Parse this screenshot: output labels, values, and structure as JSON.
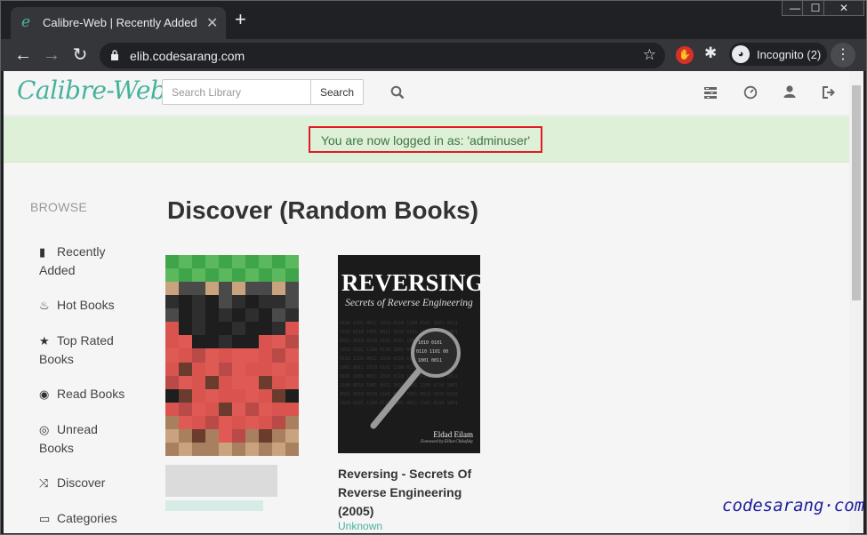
{
  "browser": {
    "tab_title": "Calibre-Web | Recently Added Bo",
    "favicon": "e",
    "tab_close": "✕",
    "new_tab": "+",
    "url": "elib.codesarang.com",
    "incognito_label": "Incognito (2)",
    "window_controls": {
      "minimize": "—",
      "maximize": "☐",
      "close": "✕"
    }
  },
  "app": {
    "brand": "Calibre-Web",
    "search": {
      "placeholder": "Search Library",
      "button": "Search"
    },
    "nav_icons": [
      "tasks-icon",
      "dashboard-icon",
      "user-icon",
      "logout-icon"
    ]
  },
  "alert": {
    "message": "You are now logged in as: 'adminuser'"
  },
  "sidebar": {
    "heading": "BROWSE",
    "items": [
      {
        "icon": "book-icon",
        "glyph": "▮",
        "label_1": "Recently",
        "label_2": "Added"
      },
      {
        "icon": "fire-icon",
        "glyph": "♨",
        "label_1": "Hot Books",
        "label_2": ""
      },
      {
        "icon": "star-icon",
        "glyph": "★",
        "label_1": "Top Rated",
        "label_2": "Books"
      },
      {
        "icon": "eye-icon",
        "glyph": "◉",
        "label_1": "Read Books",
        "label_2": ""
      },
      {
        "icon": "eye-slash-icon",
        "glyph": "◎",
        "label_1": "Unread",
        "label_2": "Books"
      },
      {
        "icon": "shuffle-icon",
        "glyph": "⤨",
        "label_1": "Discover",
        "label_2": ""
      },
      {
        "icon": "inbox-icon",
        "glyph": "▭",
        "label_1": "Categories",
        "label_2": ""
      }
    ]
  },
  "main": {
    "title": "Discover (Random Books)",
    "books": [
      {
        "cover_title": "REVERSING",
        "cover_subtitle": "Secrets of Reverse Engineering",
        "cover_author": "Eldad Eilam",
        "cover_foreword": "Foreword by Elliot Chikofsky",
        "title_line_1": "Reversing - Secrets Of",
        "title_line_2": "Reverse Engineering",
        "title_line_3": "(2005)",
        "author": "Unknown"
      }
    ]
  },
  "watermark": "codesarang·com",
  "colors": {
    "brand": "#45b29d",
    "alert_bg": "#dff0d8",
    "alert_text": "#3c763d",
    "highlight_box": "#e11a22"
  }
}
